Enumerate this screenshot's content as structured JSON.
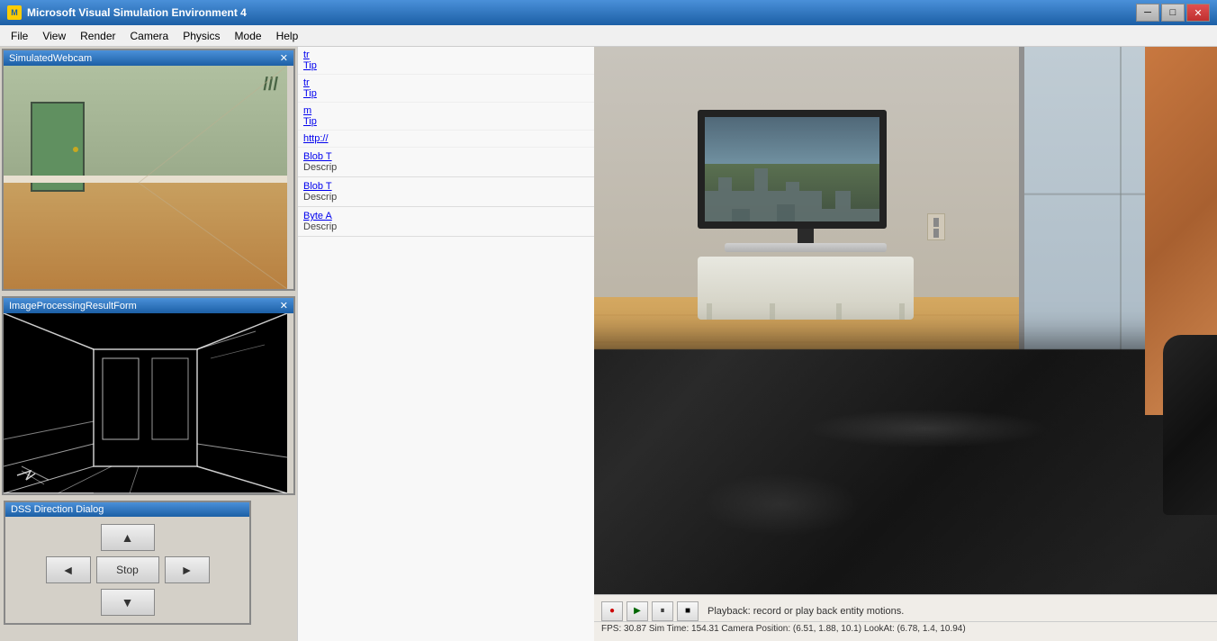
{
  "app": {
    "title": "Microsoft Visual Simulation Environment 4",
    "icon_label": "MVSE"
  },
  "title_bar": {
    "title": "Microsoft Visual Simulation Environment 4",
    "minimize_label": "─",
    "maximize_label": "□",
    "close_label": "✕"
  },
  "menu": {
    "items": [
      "File",
      "View",
      "Render",
      "Camera",
      "Physics",
      "Mode",
      "Help"
    ]
  },
  "left_panel": {
    "webcam_title": "SimulatedWebcam",
    "imgproc_title": "ImageProcessingResultForm"
  },
  "dss_dialog": {
    "title": "DSS Direction Dialog",
    "up_label": "▲",
    "left_label": "◄",
    "stop_label": "Stop",
    "right_label": "►",
    "down_label": "▼"
  },
  "blob_panel": {
    "entries": [
      {
        "title": "Blob T",
        "desc": "Descrip"
      },
      {
        "title": "Blob T",
        "desc": "Descrip"
      },
      {
        "title": "Byte A",
        "desc": "Descrip"
      }
    ]
  },
  "playback": {
    "text": "Playback: record or play back entity motions.",
    "record_label": "●",
    "play_label": "▶",
    "pause_label": "⏸",
    "stop_label": "■"
  },
  "status_bar": {
    "fps": "FPS: 30.87",
    "sim_time": "Sim Time: 154.31",
    "camera_pos": "Camera Position: (6.51, 1.88, 10.1)",
    "lookat": "LookAt: (6.78, 1.4, 10.94)"
  },
  "colors": {
    "title_bar_start": "#4a90d9",
    "title_bar_end": "#1c5fa5",
    "accent_blue": "#0000cc",
    "menu_bg": "#f0f0f0"
  }
}
